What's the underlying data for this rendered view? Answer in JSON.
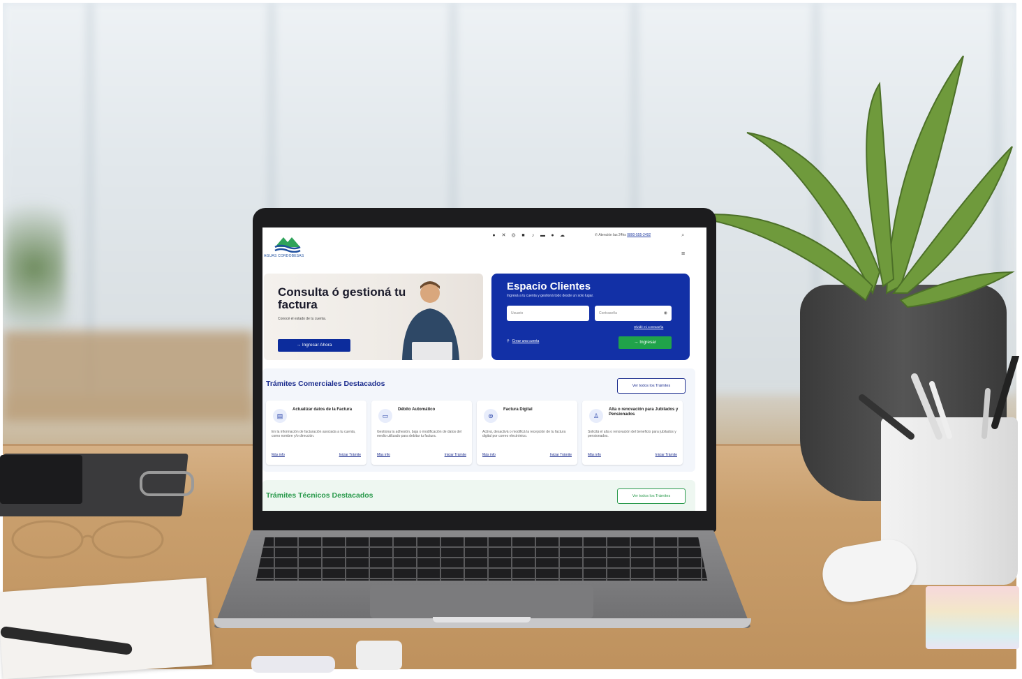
{
  "site": {
    "logo_text": "AGUAS CORDOBESAS",
    "social_icons": [
      "facebook-icon",
      "x-icon",
      "instagram-icon",
      "linkedin-icon",
      "tiktok-icon",
      "youtube-icon",
      "whatsapp-icon",
      "cloud-icon"
    ],
    "phone_prefix": "Atención las 24hs",
    "phone_number": "0800-555-2492",
    "hero": {
      "title": "Consulta ó gestioná tu factura",
      "subtitle": "Conocé el estado de tu cuenta.",
      "cta": "→ Ingresar Ahora"
    },
    "clients": {
      "title": "Espacio Clientes",
      "subtitle": "Ingresá a tu cuenta y gestioná todo desde un solo lugar.",
      "user_placeholder": "Usuario",
      "pass_placeholder": "Contraseña",
      "forgot": "Olvidé mi contraseña",
      "create_account": "Crear una cuenta",
      "login": "→ Ingresar"
    },
    "commercial": {
      "title": "Trámites Comerciales Destacados",
      "see_all": "Ver todos los Trámites",
      "cards": [
        {
          "title": "Actualizar datos de la Factura",
          "desc": "En la información de facturación asociada a tu cuenta, como nombre y/o dirección.",
          "more": "Más info",
          "start": "Iniciar Trámite",
          "icon": "document-icon"
        },
        {
          "title": "Débito Automático",
          "desc": "Gestiona la adhesión, baja o modificación de datos del medio utilizado para debitar tu factura.",
          "more": "Más info",
          "start": "Iniciar Trámite",
          "icon": "card-icon"
        },
        {
          "title": "Factura Digital",
          "desc": "Activá, desactivá o modificá la recepción de tu factura digital por correo electrónico.",
          "more": "Más info",
          "start": "Iniciar Trámite",
          "icon": "digital-invoice-icon"
        },
        {
          "title": "Alta o renovación para Jubilados y Pensionados",
          "desc": "Solicitá el alta o renovación del beneficio para jubilados y pensionados.",
          "more": "Más info",
          "start": "Iniciar Trámite",
          "icon": "person-icon"
        }
      ]
    },
    "technical": {
      "title": "Trámites Técnicos Destacados",
      "see_all": "Ver todos los Trámites"
    }
  }
}
